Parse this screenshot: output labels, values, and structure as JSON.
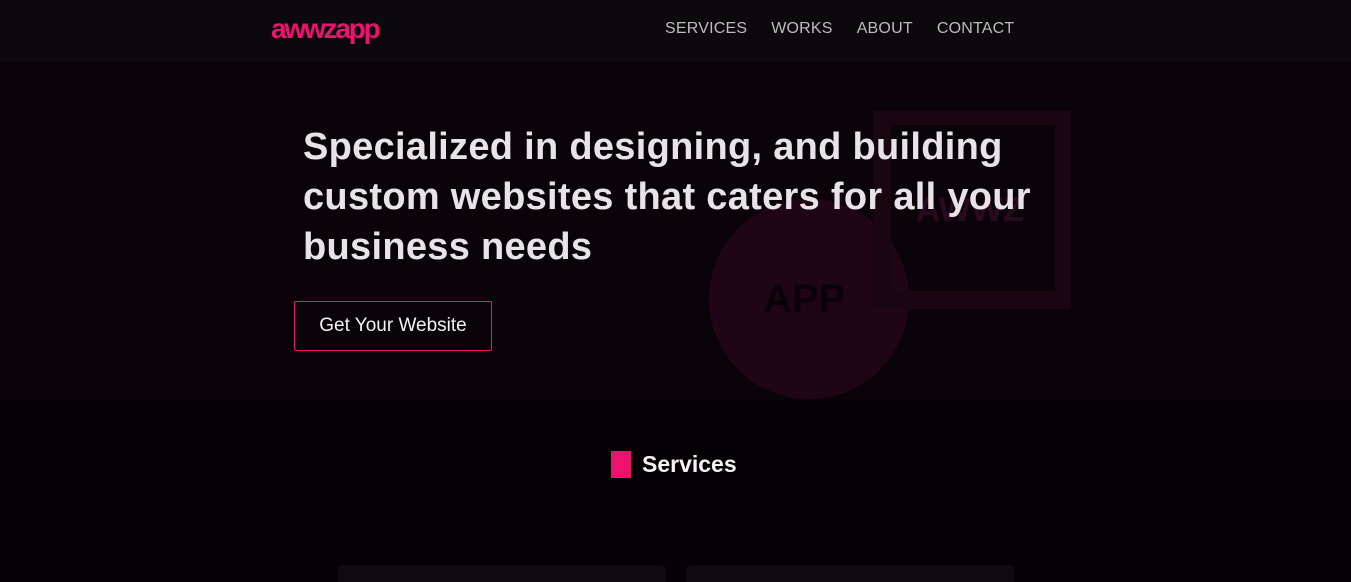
{
  "header": {
    "logo": "awwzapp",
    "nav": [
      "SERVICES",
      "WORKS",
      "ABOUT",
      "CONTACT"
    ]
  },
  "hero": {
    "title": "Specialized in designing, and building custom websites that caters for all your business needs",
    "cta_label": "Get Your Website",
    "background_labels": {
      "box": "AWWZ",
      "circle": "APP"
    }
  },
  "services": {
    "title": "Services"
  },
  "colors": {
    "accent": "#ec136e",
    "background": "#050105",
    "header": "#0b090b",
    "text": "#e7e3e7"
  }
}
